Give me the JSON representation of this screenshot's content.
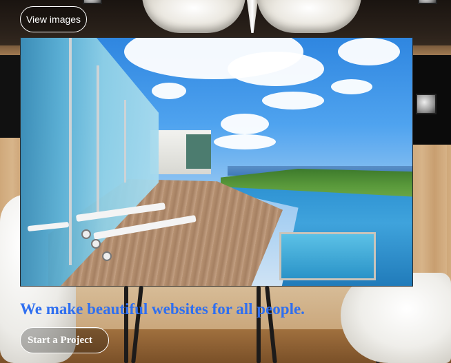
{
  "page": {
    "view_images_label": "View images",
    "headline": "We make beautiful websites for all people.",
    "start_project_label": "Start a Project"
  },
  "colors": {
    "headline": "#2f6ff0",
    "button_border": "#ffffff",
    "button_text": "#ffffff"
  },
  "images": {
    "background": "wood-paneled interior with white pendant lamps, white chairs and dark table legs",
    "hero_photo": "glass beach house with wooden deck, white sun loungers and infinity pool under blue sky"
  }
}
